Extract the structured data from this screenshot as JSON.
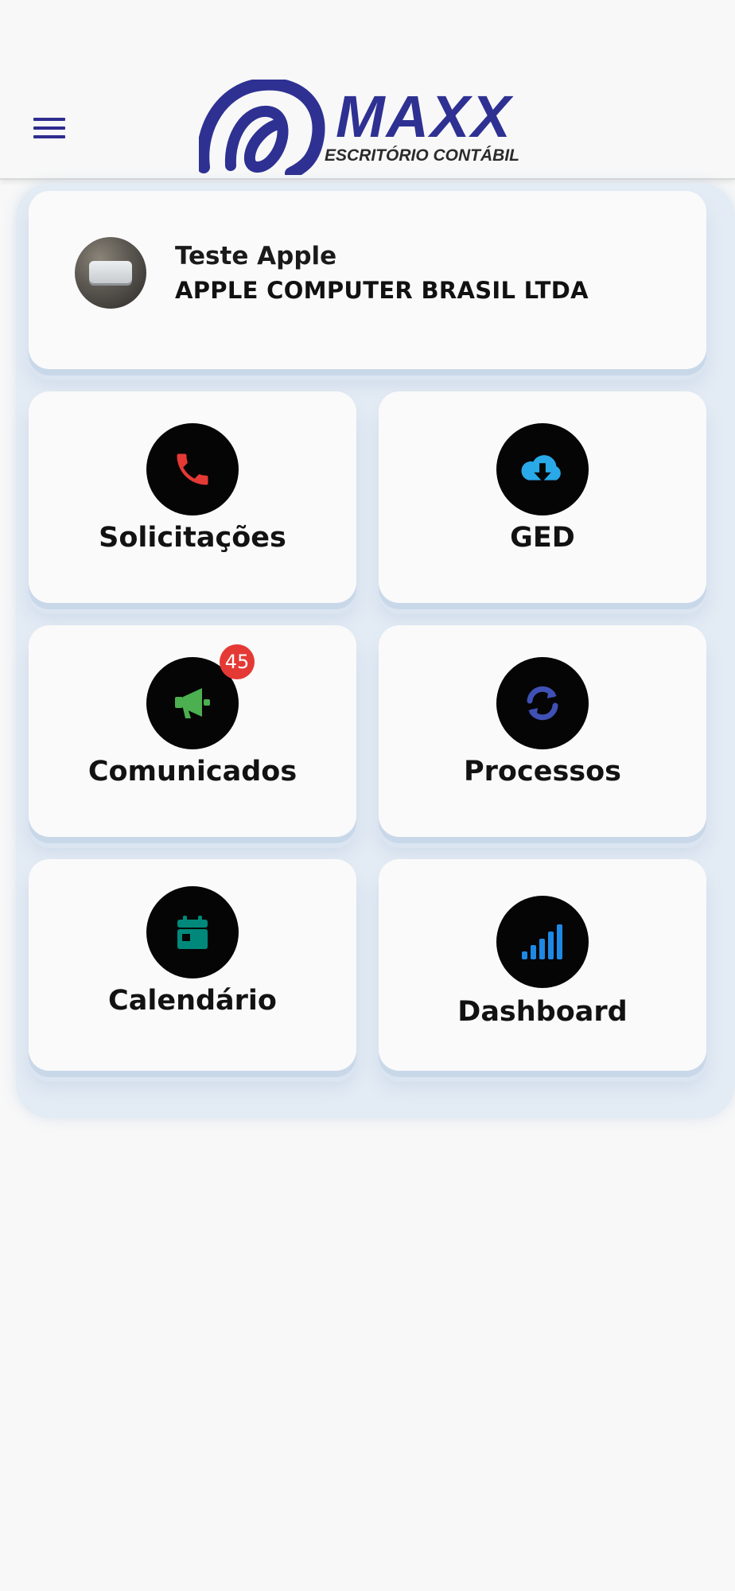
{
  "header": {
    "menu_icon": "hamburger-menu-icon",
    "logo": {
      "brand": "MAXX",
      "tagline": "ESCRITÓRIO CONTÁBIL"
    }
  },
  "profile": {
    "name": "Teste Apple",
    "company": "APPLE COMPUTER BRASIL LTDA"
  },
  "tiles": [
    {
      "label": "Solicitações",
      "icon": "phone-icon",
      "icon_color": "#e53935"
    },
    {
      "label": "GED",
      "icon": "cloud-download-icon",
      "icon_color": "#29a9e8"
    },
    {
      "label": "Comunicados",
      "icon": "megaphone-icon",
      "icon_color": "#4caf50",
      "badge": "45"
    },
    {
      "label": "Processos",
      "icon": "sync-icon",
      "icon_color": "#3f51b5"
    },
    {
      "label": "Calendário",
      "icon": "calendar-icon",
      "icon_color": "#00897b"
    },
    {
      "label": "Dashboard",
      "icon": "signal-bars-icon",
      "icon_color": "#1e88e5"
    }
  ],
  "colors": {
    "brand": "#2e3192",
    "badge": "#e53935",
    "background": "#f8f8f8"
  }
}
